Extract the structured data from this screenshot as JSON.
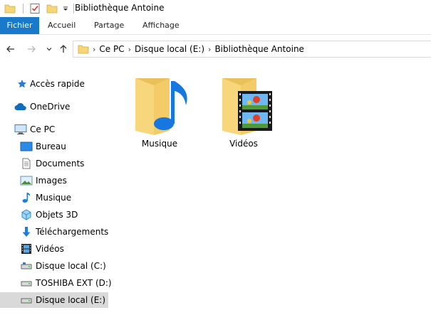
{
  "window": {
    "title": "Bibliothèque Antoine"
  },
  "quick_access_toolbar": {
    "icons": [
      "folder-icon",
      "properties-check-icon",
      "new-folder-icon",
      "customize-dropdown-icon"
    ]
  },
  "ribbon": {
    "tabs": [
      {
        "label": "Fichier",
        "active": true
      },
      {
        "label": "Accueil"
      },
      {
        "label": "Partage"
      },
      {
        "label": "Affichage"
      }
    ],
    "accent_color": "#1979ca"
  },
  "address": {
    "crumbs": [
      "Ce PC",
      "Disque local (E:)",
      "Bibliothèque Antoine"
    ]
  },
  "navigation": {
    "items": [
      {
        "label": "Accès rapide",
        "icon": "star-icon"
      },
      {
        "label": "OneDrive",
        "icon": "cloud-icon"
      },
      {
        "label": "Ce PC",
        "icon": "computer-icon"
      },
      {
        "label": "Bureau",
        "icon": "desktop-icon"
      },
      {
        "label": "Documents",
        "icon": "documents-icon"
      },
      {
        "label": "Images",
        "icon": "images-icon"
      },
      {
        "label": "Musique",
        "icon": "music-note-icon"
      },
      {
        "label": "Objets 3D",
        "icon": "cube-icon"
      },
      {
        "label": "Téléchargements",
        "icon": "download-arrow-icon"
      },
      {
        "label": "Vidéos",
        "icon": "film-icon"
      },
      {
        "label": "Disque local (C:)",
        "icon": "drive-icon"
      },
      {
        "label": "TOSHIBA EXT (D:)",
        "icon": "drive-icon"
      },
      {
        "label": "Disque local (E:)",
        "icon": "drive-icon",
        "selected": true
      }
    ]
  },
  "content": {
    "folders": [
      {
        "name": "Musique",
        "icon": "music-folder-icon"
      },
      {
        "name": "Vidéos",
        "icon": "video-folder-icon"
      }
    ]
  }
}
